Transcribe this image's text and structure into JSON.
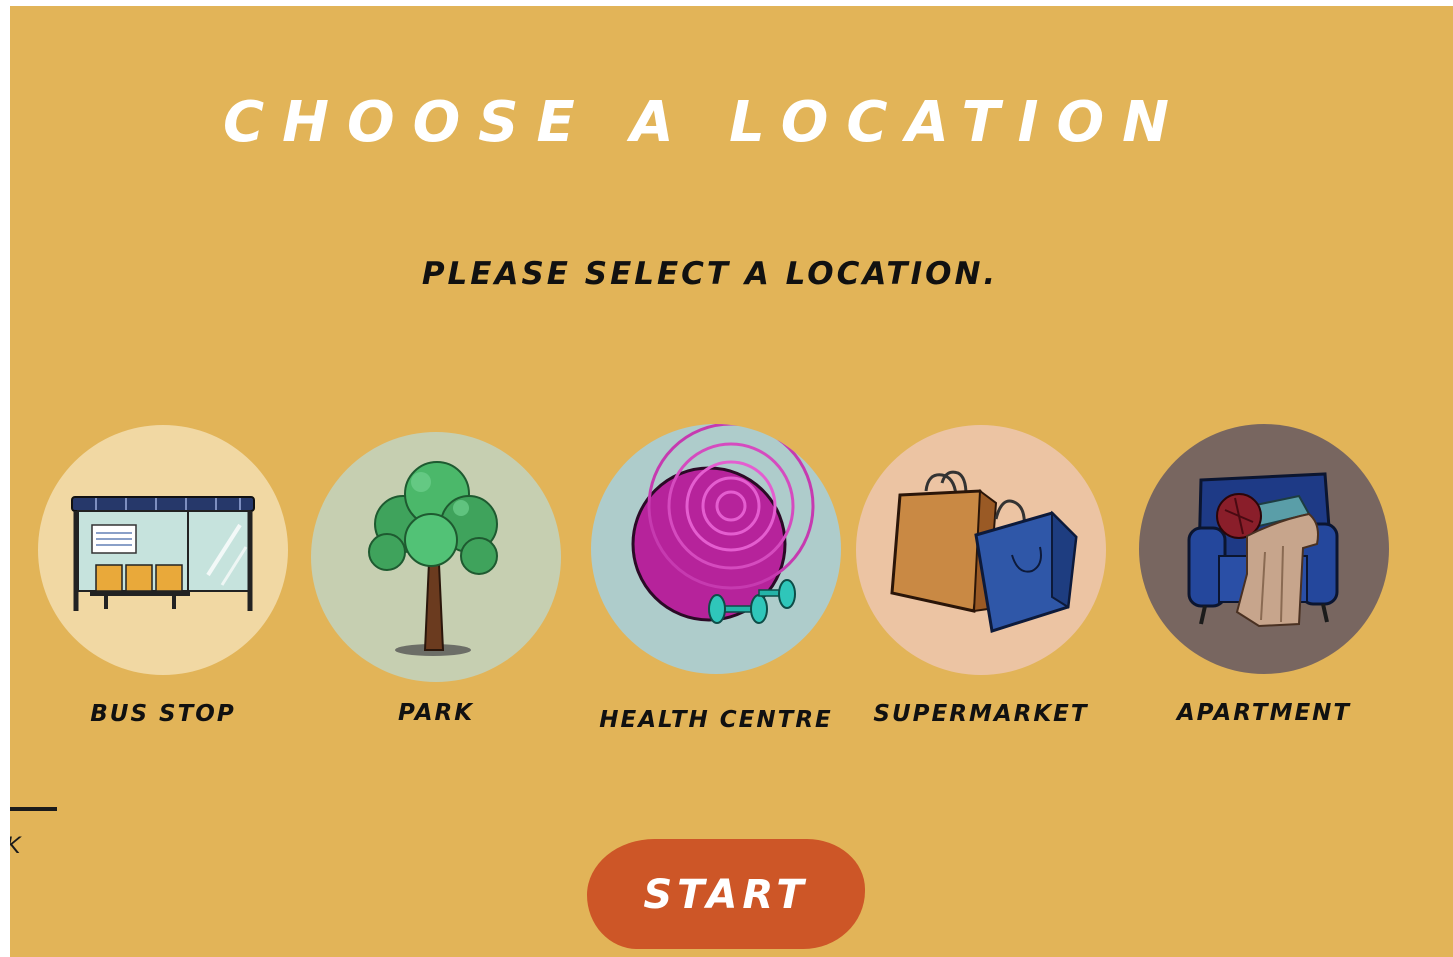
{
  "title": "CHOOSE A LOCATION",
  "subtitle": "PLEASE SELECT A LOCATION.",
  "locations": [
    {
      "label": "BUS STOP",
      "icon": "bus-stop-icon",
      "color": "#f1d8a3"
    },
    {
      "label": "PARK",
      "icon": "tree-icon",
      "color": "#c6cfb1"
    },
    {
      "label": "HEALTH CENTRE",
      "icon": "exercise-ball-icon",
      "color": "#aecccb"
    },
    {
      "label": "SUPERMARKET",
      "icon": "shopping-bags-icon",
      "color": "#ecc4a3"
    },
    {
      "label": "APARTMENT",
      "icon": "armchair-icon",
      "color": "#786660"
    }
  ],
  "back_label": "K",
  "start_label": "START",
  "colors": {
    "background": "#e2b458",
    "start_button": "#cd5627",
    "title_text": "#ffffff",
    "body_text": "#111111"
  }
}
